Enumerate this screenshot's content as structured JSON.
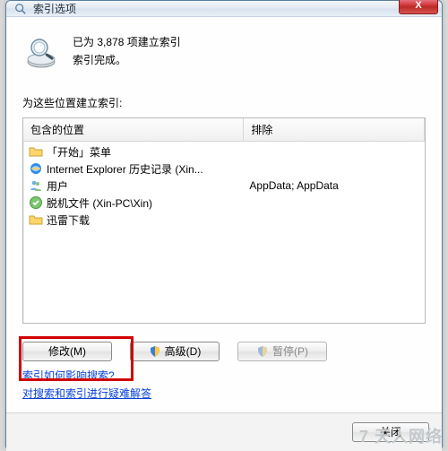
{
  "title": "索引选项",
  "status": {
    "line1": "已为 3,878 项建立索引",
    "line2": "索引完成。"
  },
  "section_label": "为这些位置建立索引:",
  "columns": {
    "included": "包含的位置",
    "excluded": "排除"
  },
  "rows": [
    {
      "icon": "folder",
      "label": "「开始」菜单",
      "excluded": ""
    },
    {
      "icon": "ie",
      "label": "Internet Explorer 历史记录 (Xin...",
      "excluded": ""
    },
    {
      "icon": "users",
      "label": "用户",
      "excluded": "AppData; AppData"
    },
    {
      "icon": "offline",
      "label": "脱机文件 (Xin-PC\\Xin)",
      "excluded": ""
    },
    {
      "icon": "folder",
      "label": "迅雷下载",
      "excluded": ""
    }
  ],
  "buttons": {
    "modify": "修改(M)",
    "advanced": "高级(D)",
    "pause": "暂停(P)",
    "close": "关闭"
  },
  "links": {
    "how_affect": "索引如何影响搜索?",
    "troubleshoot": "对搜索和索引进行疑难解答"
  },
  "close_x": "X",
  "watermark": "7 天人网络"
}
